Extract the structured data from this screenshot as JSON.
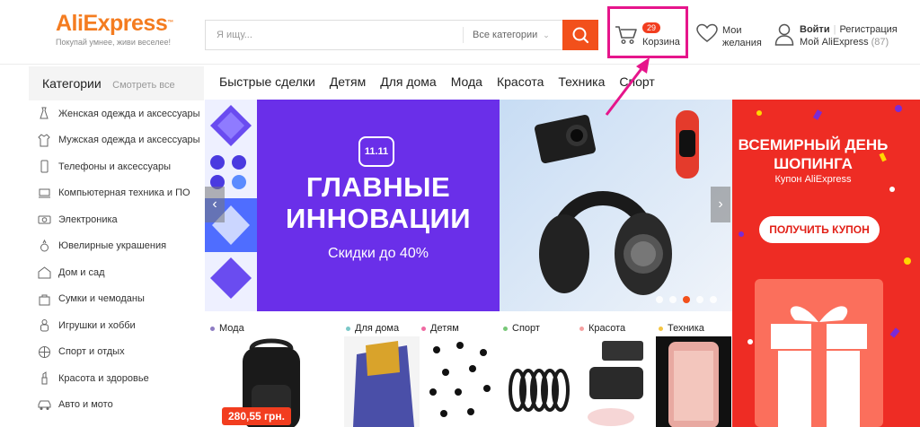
{
  "header": {
    "logo_text": "AliExpress",
    "slogan": "Покупай умнее, живи веселее!",
    "search_placeholder": "Я ищу...",
    "search_category": "Все категории",
    "cart_count": "29",
    "cart_label": "Корзина",
    "wishlist_line1": "Мои",
    "wishlist_line2": "желания",
    "login": "Войти",
    "register": "Регистрация",
    "my_account": "Мой AliExpress",
    "account_count": "(87)"
  },
  "sidebar": {
    "title": "Категории",
    "see_all": "Смотреть все",
    "items": [
      {
        "label": "Женская одежда и аксессуары",
        "icon": "dress-icon"
      },
      {
        "label": "Мужская одежда и аксессуары",
        "icon": "shirt-icon"
      },
      {
        "label": "Телефоны и аксессуары",
        "icon": "phone-icon"
      },
      {
        "label": "Компьютерная техника и ПО",
        "icon": "laptop-icon"
      },
      {
        "label": "Электроника",
        "icon": "camera-icon"
      },
      {
        "label": "Ювелирные украшения",
        "icon": "ring-icon"
      },
      {
        "label": "Дом и сад",
        "icon": "home-icon"
      },
      {
        "label": "Сумки и чемоданы",
        "icon": "bag-icon"
      },
      {
        "label": "Игрушки и хобби",
        "icon": "toy-icon"
      },
      {
        "label": "Спорт и отдых",
        "icon": "ball-icon"
      },
      {
        "label": "Красота и здоровье",
        "icon": "lipstick-icon"
      },
      {
        "label": "Авто и мото",
        "icon": "car-icon"
      }
    ]
  },
  "topnav": [
    "Быстрые сделки",
    "Детям",
    "Для дома",
    "Мода",
    "Красота",
    "Техника",
    "Спорт"
  ],
  "hero": {
    "logo": "11.11",
    "title_line1": "ГЛАВНЫЕ",
    "title_line2": "ИННОВАЦИИ",
    "subtitle": "Скидки до 40%",
    "prev": "‹",
    "next": "›"
  },
  "promo": {
    "title_line1": "ВСЕМИРНЫЙ ДЕНЬ",
    "title_line2": "ШОПИНГА",
    "subtitle": "Купон AliExpress",
    "button": "ПОЛУЧИТЬ КУПОН"
  },
  "products": {
    "categories": [
      {
        "label": "Мода",
        "color": "#8e7cc3"
      },
      {
        "label": "Для дома",
        "color": "#7bc8c8"
      },
      {
        "label": "Детям",
        "color": "#f06aa2"
      },
      {
        "label": "Спорт",
        "color": "#78c878"
      },
      {
        "label": "Красота",
        "color": "#f5a0a0"
      },
      {
        "label": "Техника",
        "color": "#f5c542"
      }
    ],
    "price": "280,55 грн."
  },
  "colors": {
    "brand_orange": "#f2501b",
    "highlight_pink": "#e6158b",
    "hero_purple": "#6a2fe9",
    "promo_red": "#ee2c24"
  }
}
